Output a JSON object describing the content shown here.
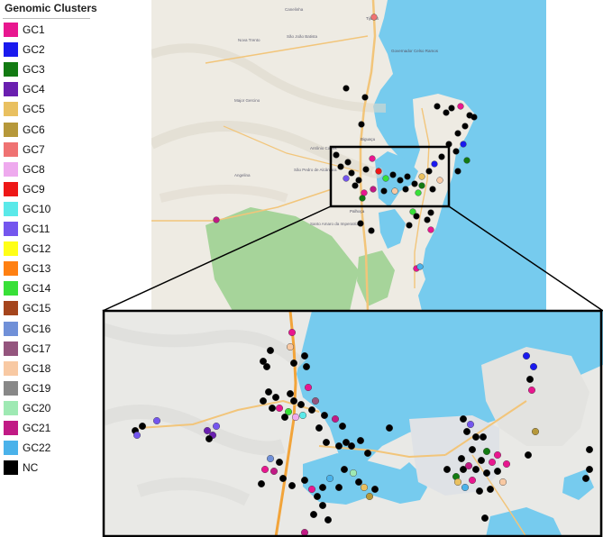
{
  "legend": {
    "title": "Genomic Clusters",
    "items": [
      {
        "label": "GC1",
        "color": "#e8178f"
      },
      {
        "label": "GC2",
        "color": "#1a1aee"
      },
      {
        "label": "GC3",
        "color": "#127a12"
      },
      {
        "label": "GC4",
        "color": "#6a1fb0"
      },
      {
        "label": "GC5",
        "color": "#e9c060"
      },
      {
        "label": "GC6",
        "color": "#b6983a"
      },
      {
        "label": "GC7",
        "color": "#ef7272"
      },
      {
        "label": "GC8",
        "color": "#eeaaee"
      },
      {
        "label": "GC9",
        "color": "#ee1717"
      },
      {
        "label": "GC10",
        "color": "#5ae9e9"
      },
      {
        "label": "GC11",
        "color": "#7456ee"
      },
      {
        "label": "GC12",
        "color": "#ffff17"
      },
      {
        "label": "GC13",
        "color": "#ff8012"
      },
      {
        "label": "GC14",
        "color": "#38e038"
      },
      {
        "label": "GC15",
        "color": "#a5451d"
      },
      {
        "label": "GC16",
        "color": "#7090d8"
      },
      {
        "label": "GC17",
        "color": "#94557e"
      },
      {
        "label": "GC18",
        "color": "#f8c9a3"
      },
      {
        "label": "GC19",
        "color": "#888888"
      },
      {
        "label": "GC20",
        "color": "#9ee9b3"
      },
      {
        "label": "GC21",
        "color": "#c11a85"
      },
      {
        "label": "GC22",
        "color": "#4ab2ea"
      },
      {
        "label": "NC",
        "color": "#000000"
      }
    ]
  },
  "map_labels": [
    "Canelinha",
    "Nova Trento",
    "São João Batista",
    "Major Gercino",
    "Angelina",
    "Biguaçu",
    "Antônio Carlos",
    "São Pedro de Alcântara",
    "Palhoça",
    "Santo Amaro da Imperatriz",
    "Governador Celso Ramos",
    "Tijucas"
  ],
  "colors": {
    "water": "#76cbee",
    "land": "#eeebe3",
    "forest": "#a6d49a",
    "road": "#f2c57a",
    "urban": "#dde0e3",
    "frame": "#000000"
  }
}
